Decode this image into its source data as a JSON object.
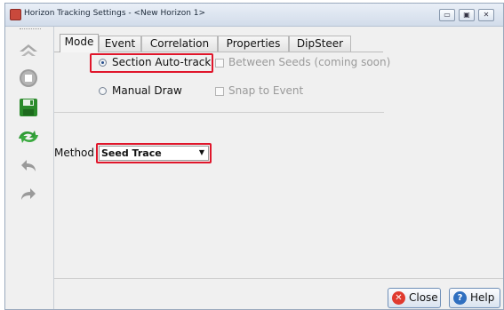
{
  "window": {
    "title": "Horizon Tracking Settings - <New Horizon 1>",
    "controls": [
      "▭",
      "▣",
      "✕"
    ]
  },
  "tabs": [
    {
      "label": "Mode",
      "active": true
    },
    {
      "label": "Event"
    },
    {
      "label": "Correlation"
    },
    {
      "label": "Properties"
    },
    {
      "label": "DipSteer"
    }
  ],
  "mode": {
    "section_autotrack": "Section Auto-track",
    "between_seeds": "Between Seeds (coming soon)",
    "manual_draw": "Manual Draw",
    "snap_to_event": "Snap to Event"
  },
  "method": {
    "label": "Method",
    "value": "Seed Trace"
  },
  "buttons": {
    "close": "Close",
    "help": "Help"
  },
  "colors": {
    "highlight": "#e0162b",
    "close_icon": "#e03a2f",
    "help_icon": "#2f6fc0"
  }
}
